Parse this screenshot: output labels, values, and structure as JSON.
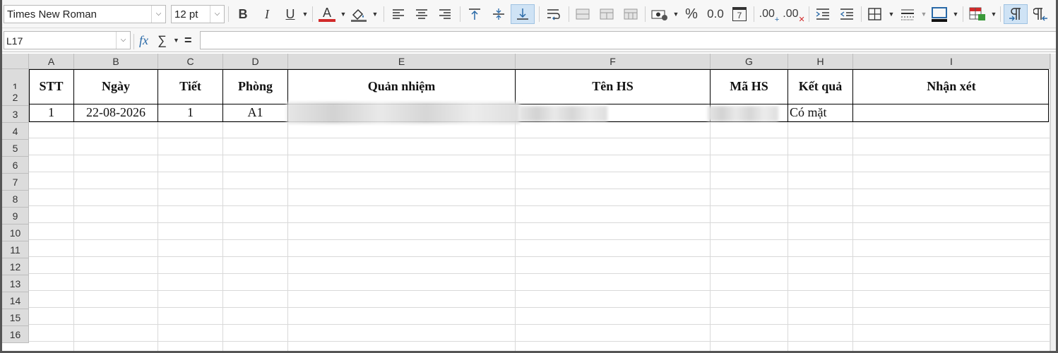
{
  "toolbar": {
    "font_name": "Times New Roman",
    "font_size": "12 pt",
    "bold": "B",
    "italic": "I",
    "underline": "U",
    "font_color_glyph": "A",
    "font_color": "#d22a2a",
    "percent": "%",
    "number_format": "0.0",
    "add_decimal": ".00",
    "del_decimal": ".00",
    "calendar_day": "7"
  },
  "formula_bar": {
    "cell_ref": "L17",
    "fx": "fx",
    "sum": "∑",
    "equals": "=",
    "content": ""
  },
  "columns": [
    "A",
    "B",
    "C",
    "D",
    "E",
    "F",
    "G",
    "H",
    "I"
  ],
  "rows": [
    "1",
    "2",
    "3",
    "4",
    "5",
    "6",
    "7",
    "8",
    "9",
    "10",
    "11",
    "12",
    "13",
    "14",
    "15",
    "16"
  ],
  "headers": [
    "STT",
    "Ngày",
    "Tiết",
    "Phòng",
    "Quản nhiệm",
    "Tên HS",
    "Mã HS",
    "Kết quả",
    "Nhận xét"
  ],
  "record": {
    "stt": "1",
    "date": "22-08-2026",
    "period": "1",
    "room": "A1",
    "result": "Có mặt",
    "comment": ""
  }
}
